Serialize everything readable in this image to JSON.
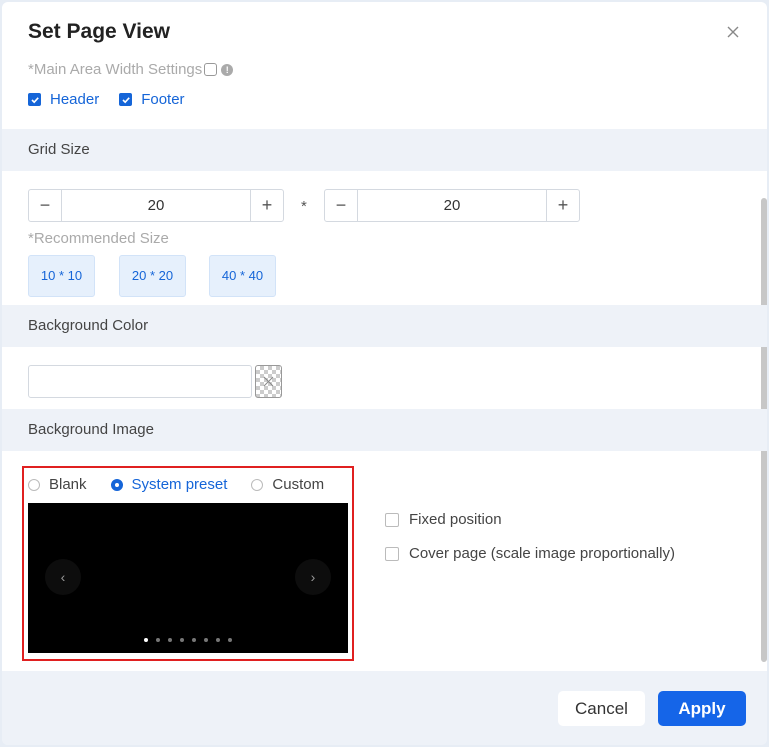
{
  "dialog": {
    "title": "Set Page View",
    "close_icon": "close-icon"
  },
  "layout": {
    "main_area_label": "*Main Area Width Settings",
    "header_label": "Header",
    "footer_label": "Footer",
    "header_checked": true,
    "footer_checked": true
  },
  "grid": {
    "section_title": "Grid Size",
    "width_value": "20",
    "height_value": "20",
    "separator": "*",
    "recommended_label": "*Recommended Size",
    "presets": [
      "10 * 10",
      "20 * 20",
      "40 * 40"
    ]
  },
  "background_color": {
    "section_title": "Background Color",
    "value": ""
  },
  "background_image": {
    "section_title": "Background Image",
    "options": [
      "Blank",
      "System preset",
      "Custom"
    ],
    "selected": "System preset",
    "carousel_prev": "‹",
    "carousel_next": "›",
    "carousel_pages": 8,
    "carousel_active": 1,
    "fixed_position_label": "Fixed position",
    "cover_page_label": "Cover page (scale image proportionally)"
  },
  "footer": {
    "cancel_label": "Cancel",
    "apply_label": "Apply"
  },
  "colors": {
    "accent": "#1565d8",
    "highlight_border": "#e02020"
  }
}
